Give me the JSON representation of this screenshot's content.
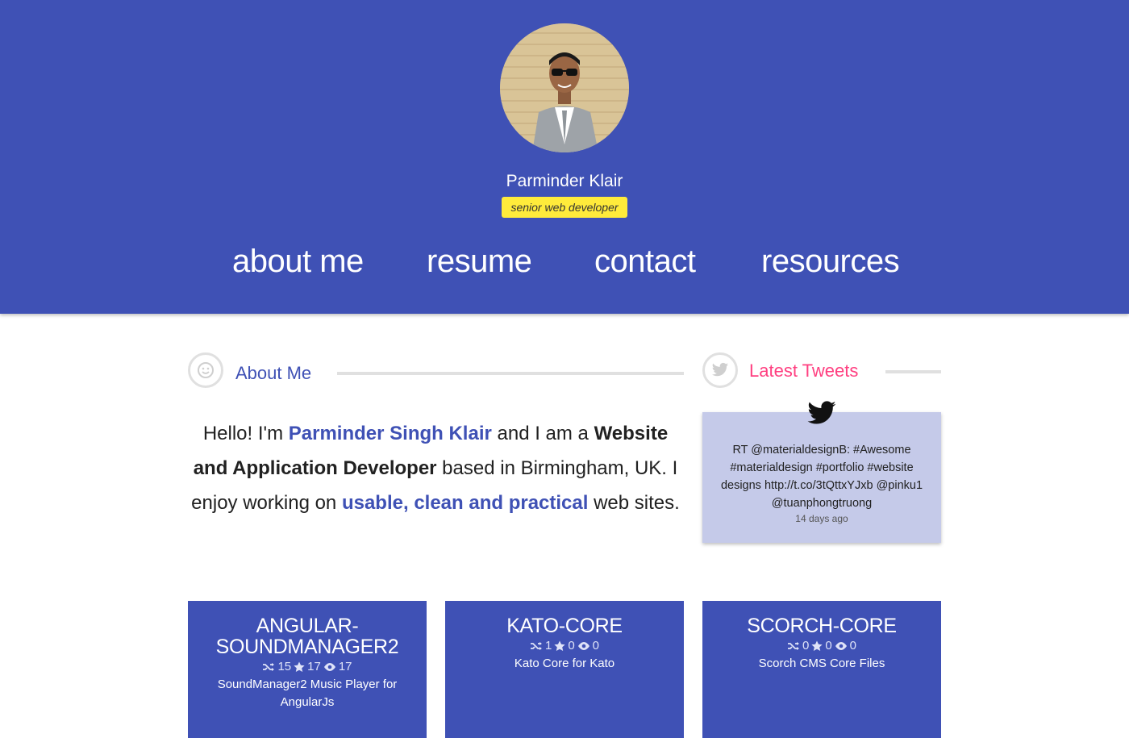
{
  "profile": {
    "name": "Parminder Klair",
    "role": "senior web developer"
  },
  "nav": {
    "items": [
      {
        "label": "about me"
      },
      {
        "label": "resume"
      },
      {
        "label": "contact"
      },
      {
        "label": "resources"
      }
    ]
  },
  "about": {
    "heading": "About Me",
    "icon": "smiley-icon",
    "text": {
      "p1": "Hello! I'm ",
      "name": "Parminder Singh Klair",
      "p2": " and I am a ",
      "title": "Website and Application Developer",
      "p3": " based in Birmingham, UK. I enjoy working on ",
      "qualities": "usable, clean and practical",
      "p4": " web sites."
    }
  },
  "tweets": {
    "heading": "Latest Tweets",
    "icon": "twitter-icon",
    "items": [
      {
        "text": "RT @materialdesignB: #Awesome #materialdesign #portfolio #website designs http://t.co/3tQttxYJxb @pinku1 @tuanphongtruong",
        "time": "14 days ago"
      }
    ]
  },
  "repos": [
    {
      "title": "ANGULAR-SOUNDMANAGER2",
      "forks": "15",
      "stars": "17",
      "watchers": "17",
      "description": "SoundManager2 Music Player for AngularJs"
    },
    {
      "title": "KATO-CORE",
      "forks": "1",
      "stars": "0",
      "watchers": "0",
      "description": "Kato Core for Kato"
    },
    {
      "title": "SCORCH-CORE",
      "forks": "0",
      "stars": "0",
      "watchers": "0",
      "description": "Scorch CMS Core Files"
    }
  ],
  "colors": {
    "primary": "#3f51b5",
    "accent": "#ff4081",
    "badge": "#ffeb3b",
    "tweet_card": "#c5cae9"
  }
}
